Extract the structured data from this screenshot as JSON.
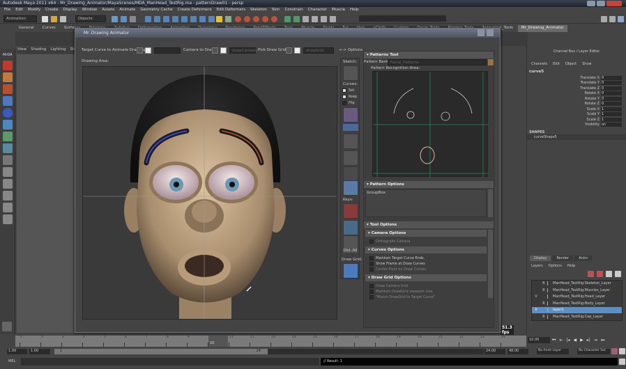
{
  "window": {
    "title": "Autodesk Maya 2011 x64 - Mr_Drawing_Animator/MayaScenes/MDA_ManHead_TestRig.ma - patternDraw01 - persp"
  },
  "menubar": [
    "File",
    "Edit",
    "Modify",
    "Create",
    "Display",
    "Window",
    "Assets",
    "Animate",
    "Geometry Cache",
    "Create Deformers",
    "Edit Deformers",
    "Skeleton",
    "Skin",
    "Constrain",
    "Character",
    "Muscle",
    "Help"
  ],
  "status": {
    "mode": "Animation",
    "selection_mode": "Objects"
  },
  "shelf_tabs": [
    "General",
    "Curves",
    "Surfaces",
    "Polygons",
    "Subdivs",
    "Deformation",
    "Animation",
    "Dynamics",
    "Rendering",
    "PaintEffects",
    "Toon",
    "Muscle",
    "Fluids",
    "Fur",
    "Hair",
    "nCloth",
    "Custom",
    "Oscar_Tools",
    "Rigging_Tools",
    "Animation_Tools",
    "Mr_Drawing_Animator"
  ],
  "shelf_active": "Mr_Drawing_Animator",
  "shelf_icon_label": "MrDA",
  "viewport_menu": [
    "View",
    "Shading",
    "Lighting",
    "Show"
  ],
  "dialog": {
    "title": "Mr. Drawing Animator",
    "target_curve_label": "Target Curve to Animate Drawing:",
    "target_curve_value": "",
    "camera_label": "Camera to Draw:",
    "camera_placeholder": "drawCamera",
    "draw_grid_label": "Pick Draw Grid:",
    "draw_grid_placeholder": "drawGrid",
    "options_toggle": "<-> Options",
    "drawing_area_label": "Drawing Area:",
    "fps": "51.3 fps",
    "sketch_label": "Sketch:",
    "curves_label": "Curves:",
    "curve_checks": [
      {
        "label": "Set",
        "checked": true
      },
      {
        "label": "Keep",
        "checked": true
      },
      {
        "label": "Flip",
        "checked": false
      }
    ],
    "keys_label": "Keys:",
    "del_all": "Del. All",
    "draw_grid_col_label": "Draw Grid:"
  },
  "patterns": {
    "header": "Patterns Tool",
    "bank_label": "Pattern Bank:",
    "bank_value": "Facial_Patterns",
    "recognition_label": "Pattern Recognition Area:",
    "options_header": "Pattern Options",
    "groupbox": "GroupBox",
    "tool_options_header": "Tool Options",
    "camera_options_header": "Camera Options",
    "camera_options": [
      {
        "label": "Orthografic Camera",
        "enabled": false
      }
    ],
    "curves_options_header": "Curves Options",
    "curves_options": [
      {
        "label": "Maintain Target Curve Ends.",
        "enabled": true
      },
      {
        "label": "Show Frame at Draw Curves",
        "enabled": true
      },
      {
        "label": "Center Pivot on Draw Curves",
        "enabled": false
      }
    ],
    "draw_grid_options_header": "Draw Grid Options",
    "draw_grid_options": [
      {
        "label": "Draw Camera Grid",
        "enabled": false
      },
      {
        "label": "Maintain DrawGrid viewport size",
        "enabled": false
      },
      {
        "label": "\"Match DrawGrid to Target Curve\"",
        "enabled": false
      }
    ]
  },
  "channel_box": {
    "title": "Channel Box / Layer Editor",
    "menu": [
      "Channels",
      "Edit",
      "Object",
      "Show"
    ],
    "object": "curve5",
    "channels": [
      {
        "name": "Translate X",
        "value": "0"
      },
      {
        "name": "Translate Y",
        "value": "0"
      },
      {
        "name": "Translate Z",
        "value": "0"
      },
      {
        "name": "Rotate X",
        "value": "0"
      },
      {
        "name": "Rotate Y",
        "value": "0"
      },
      {
        "name": "Rotate Z",
        "value": "0"
      },
      {
        "name": "Scale X",
        "value": "1"
      },
      {
        "name": "Scale Y",
        "value": "1"
      },
      {
        "name": "Scale Z",
        "value": "1"
      },
      {
        "name": "Visibility",
        "value": "on"
      }
    ],
    "shapes_label": "SHAPES",
    "shape": "curveShape5"
  },
  "layer_editor": {
    "tabs": [
      "Display",
      "Render",
      "Anim"
    ],
    "active_tab": "Display",
    "menu": [
      "Layers",
      "Options",
      "Help"
    ],
    "layers": [
      {
        "v": "",
        "r": "R",
        "name": "ManHead_TestRig:Skeleton_Layer",
        "selected": false
      },
      {
        "v": "",
        "r": "R",
        "name": "ManHead_TestRig:Muscles_Layer",
        "selected": false
      },
      {
        "v": "V",
        "r": "",
        "name": "ManHead_TestRig:Head_Layer",
        "selected": false
      },
      {
        "v": "",
        "r": "R",
        "name": "ManHead_TestRig:Body_Layer",
        "selected": false
      },
      {
        "v": "V",
        "r": "",
        "name": "layer1",
        "selected": true
      },
      {
        "v": "",
        "r": "R",
        "name": "ManHead_TestRig:Cap_Layer",
        "selected": false
      }
    ]
  },
  "timeline": {
    "ticks": [
      "1",
      "2",
      "3",
      "4",
      "5",
      "6",
      "7",
      "8",
      "9",
      "10",
      "11",
      "12",
      "13",
      "14",
      "15",
      "16",
      "17",
      "18",
      "19",
      "20",
      "21",
      "22",
      "23",
      "24"
    ],
    "current_frame": "10",
    "current_time_field": "10.00"
  },
  "range": {
    "start": "1.00",
    "start2": "1.00",
    "range_start": "1",
    "range_end": "24",
    "end": "24.00",
    "end2": "48.00",
    "anim_layer": "No Anim Layer",
    "character_set": "No Character Set"
  },
  "command": {
    "lang": "MEL",
    "result": "// Result: 1"
  },
  "colors": {
    "accent": "#5a8fc7",
    "grid": "#1f8a5a",
    "bg": "#444444"
  }
}
